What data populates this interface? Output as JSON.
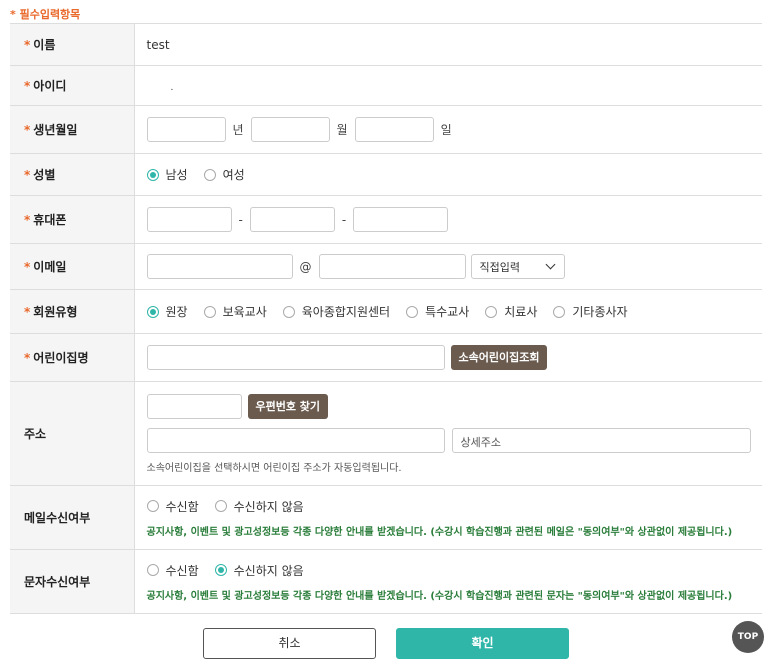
{
  "required_note": "* 필수입력항목",
  "rows": {
    "name": {
      "label": "이름",
      "value": "test"
    },
    "id": {
      "label": "아이디",
      "value": "."
    },
    "birth": {
      "label": "생년월일",
      "year_unit": "년",
      "month_unit": "월",
      "day_unit": "일"
    },
    "gender": {
      "label": "성별",
      "options": [
        "남성",
        "여성"
      ],
      "selected": "남성"
    },
    "phone": {
      "label": "휴대폰",
      "sep": "-"
    },
    "email": {
      "label": "이메일",
      "at": "@",
      "domain_select": "직접입력"
    },
    "member_type": {
      "label": "회원유형",
      "options": [
        "원장",
        "보육교사",
        "육아종합지원센터",
        "특수교사",
        "치료사",
        "기타종사자"
      ],
      "selected": "원장"
    },
    "daycare": {
      "label": "어린이집명",
      "search_button": "소속어린이집조회"
    },
    "address": {
      "label": "주소",
      "zip_button": "우편번호 찾기",
      "detail_placeholder": "상세주소",
      "hint": "소속어린이집을 선택하시면 어린이집 주소가 자동입력됩니다."
    },
    "mail_consent": {
      "label": "메일수신여부",
      "options": [
        "수신함",
        "수신하지 않음"
      ],
      "selected": "",
      "notice": "공지사항, 이벤트 및 광고성정보등 각종 다양한 안내를 받겠습니다. (수강시 학습진행과 관련된 메일은 \"동의여부\"와 상관없이 제공됩니다.)"
    },
    "sms_consent": {
      "label": "문자수신여부",
      "options": [
        "수신함",
        "수신하지 않음"
      ],
      "selected": "수신하지 않음",
      "notice": "공지사항, 이벤트 및 광고성정보등 각종 다양한 안내를 받겠습니다. (수강시 학습진행과 관련된 문자는 \"동의여부\"와 상관없이 제공됩니다.)"
    }
  },
  "buttons": {
    "cancel": "취소",
    "confirm": "확인",
    "top": "TOP"
  },
  "colors": {
    "accent": "#2fb6a9",
    "required": "#e9682b",
    "brown_button": "#6b5b4f",
    "notice": "#2a7d3a"
  }
}
